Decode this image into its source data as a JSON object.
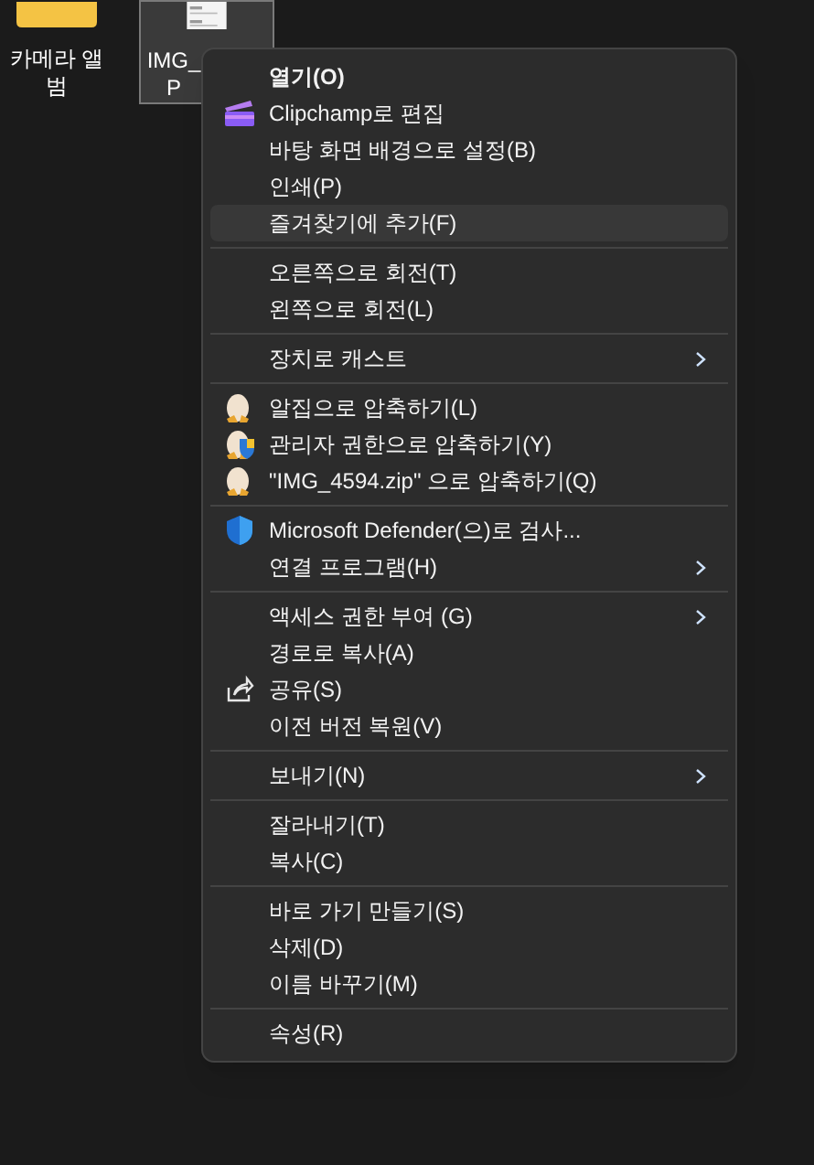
{
  "desktop_icons": [
    {
      "kind": "folder",
      "selected": false,
      "label_lines": [
        "카메라 앨",
        "범"
      ]
    },
    {
      "kind": "image",
      "selected": true,
      "label_lines": [
        "IMG_",
        "P"
      ]
    }
  ],
  "context_menu": {
    "sections": [
      [
        {
          "label": "열기(O)",
          "default": true,
          "hovered": false,
          "submenu": false
        },
        {
          "label": "Clipchamp로 편집",
          "kind": "clipchamp",
          "default": false,
          "hovered": false,
          "submenu": false
        },
        {
          "label": "바탕 화면 배경으로 설정(B)",
          "default": false,
          "hovered": false,
          "submenu": false
        },
        {
          "label": "인쇄(P)",
          "default": false,
          "hovered": false,
          "submenu": false
        },
        {
          "label": "즐겨찾기에 추가(F)",
          "default": false,
          "hovered": true,
          "submenu": false
        }
      ],
      [
        {
          "label": "오른쪽으로 회전(T)",
          "default": false,
          "hovered": false,
          "submenu": false
        },
        {
          "label": "왼쪽으로 회전(L)",
          "default": false,
          "hovered": false,
          "submenu": false
        }
      ],
      [
        {
          "label": "장치로 캐스트",
          "default": false,
          "hovered": false,
          "submenu": true
        }
      ],
      [
        {
          "label": "알집으로 압축하기(L)",
          "kind": "egg",
          "default": false,
          "hovered": false,
          "submenu": false
        },
        {
          "label": "관리자 권한으로 압축하기(Y)",
          "kind": "egg-shield",
          "default": false,
          "hovered": false,
          "submenu": false
        },
        {
          "label": "\"IMG_4594.zip\" 으로 압축하기(Q)",
          "kind": "egg",
          "default": false,
          "hovered": false,
          "submenu": false
        }
      ],
      [
        {
          "label": "Microsoft Defender(으)로 검사...",
          "kind": "shield",
          "default": false,
          "hovered": false,
          "submenu": false
        },
        {
          "label": "연결 프로그램(H)",
          "default": false,
          "hovered": false,
          "submenu": true
        }
      ],
      [
        {
          "label": "액세스 권한 부여 (G)",
          "default": false,
          "hovered": false,
          "submenu": true
        },
        {
          "label": "경로로 복사(A)",
          "default": false,
          "hovered": false,
          "submenu": false
        },
        {
          "label": "공유(S)",
          "kind": "share",
          "default": false,
          "hovered": false,
          "submenu": false
        },
        {
          "label": "이전 버전 복원(V)",
          "default": false,
          "hovered": false,
          "submenu": false
        }
      ],
      [
        {
          "label": "보내기(N)",
          "default": false,
          "hovered": false,
          "submenu": true
        }
      ],
      [
        {
          "label": "잘라내기(T)",
          "default": false,
          "hovered": false,
          "submenu": false
        },
        {
          "label": "복사(C)",
          "default": false,
          "hovered": false,
          "submenu": false
        }
      ],
      [
        {
          "label": "바로 가기 만들기(S)",
          "default": false,
          "hovered": false,
          "submenu": false
        },
        {
          "label": "삭제(D)",
          "default": false,
          "hovered": false,
          "submenu": false
        },
        {
          "label": "이름 바꾸기(M)",
          "default": false,
          "hovered": false,
          "submenu": false
        }
      ],
      [
        {
          "label": "속성(R)",
          "default": false,
          "hovered": false,
          "submenu": false
        }
      ]
    ]
  }
}
